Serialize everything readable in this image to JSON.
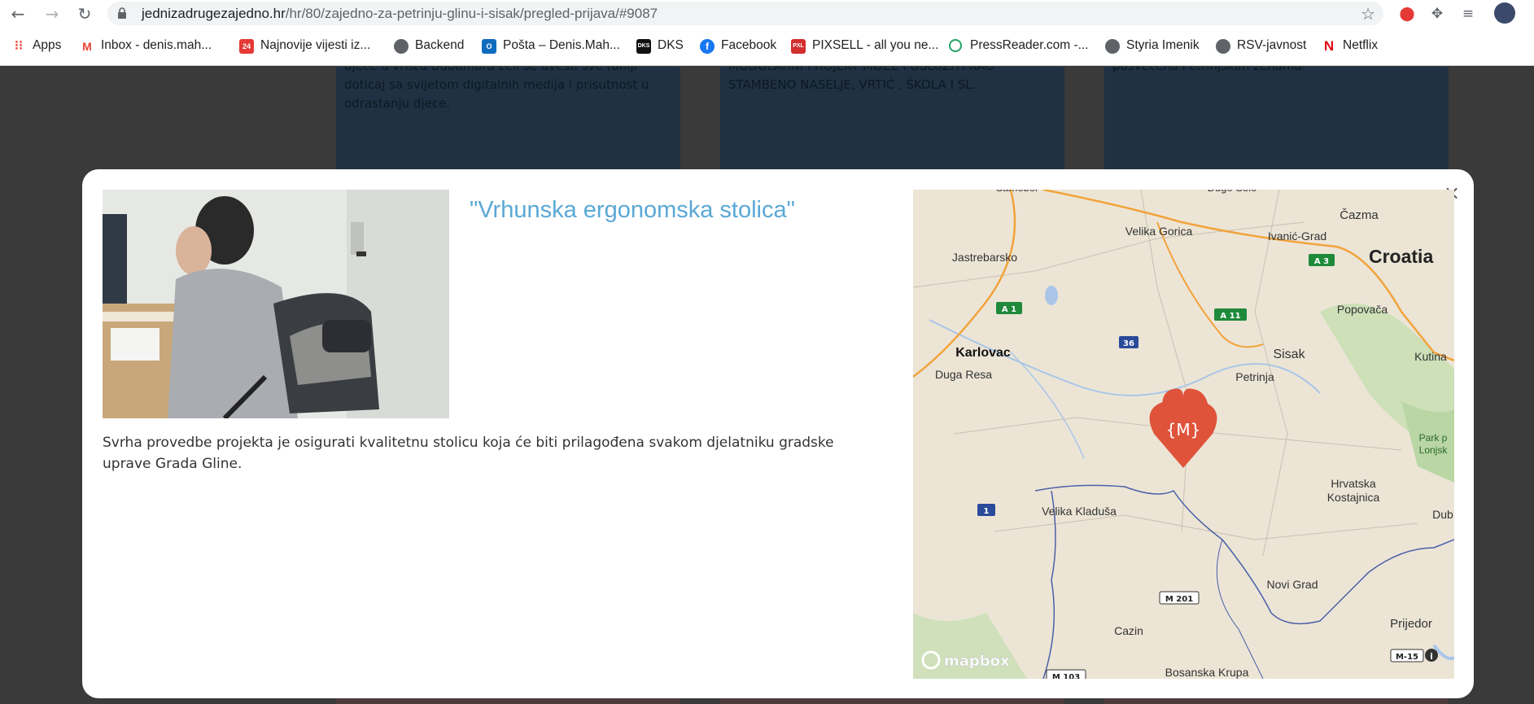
{
  "browser": {
    "url_host": "jednizadrugezajedno.hr",
    "url_path": "/hr/80/zajedno-za-petrinju-glinu-i-sisak/pregled-prijava/#9087",
    "bookmarks": [
      {
        "label": "Apps",
        "icon": "apps-grid-icon",
        "color": "#ea4335"
      },
      {
        "label": "Inbox - denis.mah...",
        "icon": "gmail-icon",
        "color": "#ea4335"
      },
      {
        "label": "Najnovije vijesti iz...",
        "icon": "news-icon",
        "color": "#e53935"
      },
      {
        "label": "Backend",
        "icon": "globe-icon",
        "color": "#5f6368"
      },
      {
        "label": "Pošta – Denis.Mah...",
        "icon": "outlook-icon",
        "color": "#0f6cbd"
      },
      {
        "label": "DKS",
        "icon": "dks-icon",
        "color": "#111111"
      },
      {
        "label": "Facebook",
        "icon": "facebook-icon",
        "color": "#1877f2"
      },
      {
        "label": "PIXSELL - all you ne...",
        "icon": "pixsell-icon",
        "color": "#d32f2f"
      },
      {
        "label": "PressReader.com -...",
        "icon": "pressreader-icon",
        "color": "#23a566"
      },
      {
        "label": "Styria Imenik",
        "icon": "globe-icon",
        "color": "#5f6368"
      },
      {
        "label": "RSV-javnost",
        "icon": "globe-icon",
        "color": "#5f6368"
      },
      {
        "label": "Netflix",
        "icon": "netflix-icon",
        "color": "#e50914"
      }
    ]
  },
  "background_cards": [
    {
      "text": "djece u vrtiću Bubamara  želi se uvesti sve raniji doticaj sa svijetom digitalnih medija i prisutnost u odrastanju djece."
    },
    {
      "text": "MODULARNI PROJEKT MOŽE POSLUŽITI KAO STAMBENO NASELJE, VRTIĆ , ŠKOLA I SL."
    },
    {
      "text": "posvećena Petrinjskim ženama"
    }
  ],
  "modal": {
    "title": "\"Vrhunska ergonomska stolica\"",
    "description": "Svrha provedbe projekta je osigurati kvalitetnu stolicu koja će biti prilagođena svakom djelatniku gradske uprave Grada Gline.",
    "close_glyph": "×",
    "photo_alt": "Man sitting at a desk on a worn office chair"
  },
  "map": {
    "country_label": "Croatia",
    "marker_label": "{M}",
    "attribution": "mapbox",
    "places": [
      "Samobor",
      "Dugo Selo",
      "Čazma",
      "Velika Gorica",
      "Ivanić-Grad",
      "Jastrebarsko",
      "Popovača",
      "Karlovac",
      "Sisak",
      "Kutina",
      "Duga Resa",
      "Petrinja",
      "Park p",
      "Lonjsk",
      "Hrvatska",
      "Kostajnica",
      "Velika Kladuša",
      "Dub",
      "Novi Grad",
      "Cazin",
      "Prijedor",
      "Bosanska Krupa"
    ],
    "roads": [
      "A 1",
      "A 3",
      "A 11",
      "36",
      "1",
      "M 201",
      "M-15",
      "M 103"
    ],
    "colors": {
      "marker": "#e0533b",
      "highway": "#f2a33b",
      "motorway_shield": "#1e8a3a",
      "road_shield": "#2a4a9a",
      "border": "#4a5fa8"
    }
  }
}
